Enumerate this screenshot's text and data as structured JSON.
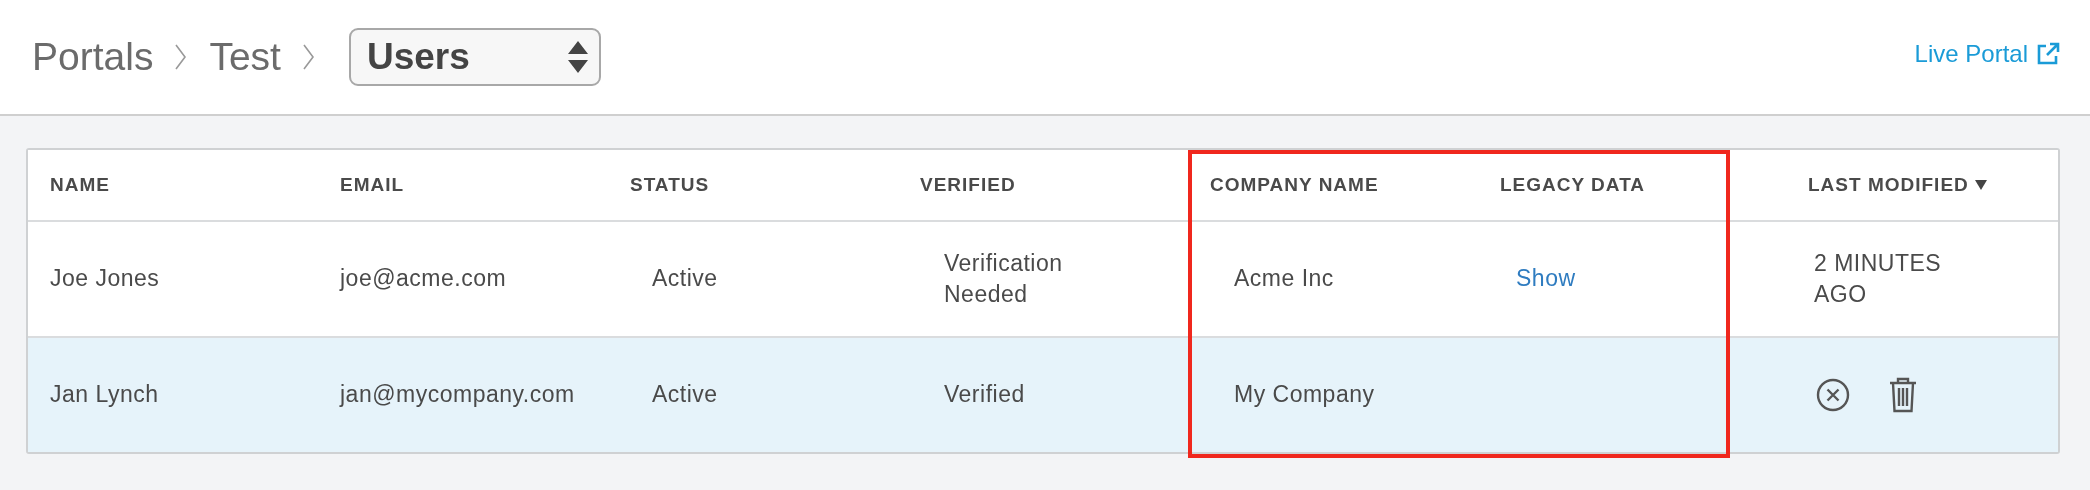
{
  "breadcrumb": [
    "Portals",
    "Test"
  ],
  "page_select": {
    "value": "Users"
  },
  "live_portal_link": "Live Portal",
  "table": {
    "columns": [
      {
        "label": "NAME",
        "highlighted": false,
        "sorted": false
      },
      {
        "label": "EMAIL",
        "highlighted": false,
        "sorted": false
      },
      {
        "label": "STATUS",
        "highlighted": false,
        "sorted": false
      },
      {
        "label": "VERIFIED",
        "highlighted": false,
        "sorted": false
      },
      {
        "label": "COMPANY NAME",
        "highlighted": true,
        "sorted": false
      },
      {
        "label": "LEGACY DATA",
        "highlighted": true,
        "sorted": false
      },
      {
        "label": "LAST MODIFIED",
        "highlighted": false,
        "sorted": true
      }
    ],
    "rows": [
      {
        "selected": false,
        "name": "Joe Jones",
        "email": "joe@acme.com",
        "status": "Active",
        "verified": "Verification Needed",
        "company": "Acme Inc",
        "legacy_link": "Show",
        "last_modified": "2 MINUTES AGO",
        "actions": []
      },
      {
        "selected": true,
        "name": "Jan Lynch",
        "email": "jan@mycompany.com",
        "status": "Active",
        "verified": "Verified",
        "company": "My Company",
        "actions": [
          {
            "kind": "cancel"
          },
          {
            "kind": "delete"
          }
        ]
      }
    ]
  }
}
